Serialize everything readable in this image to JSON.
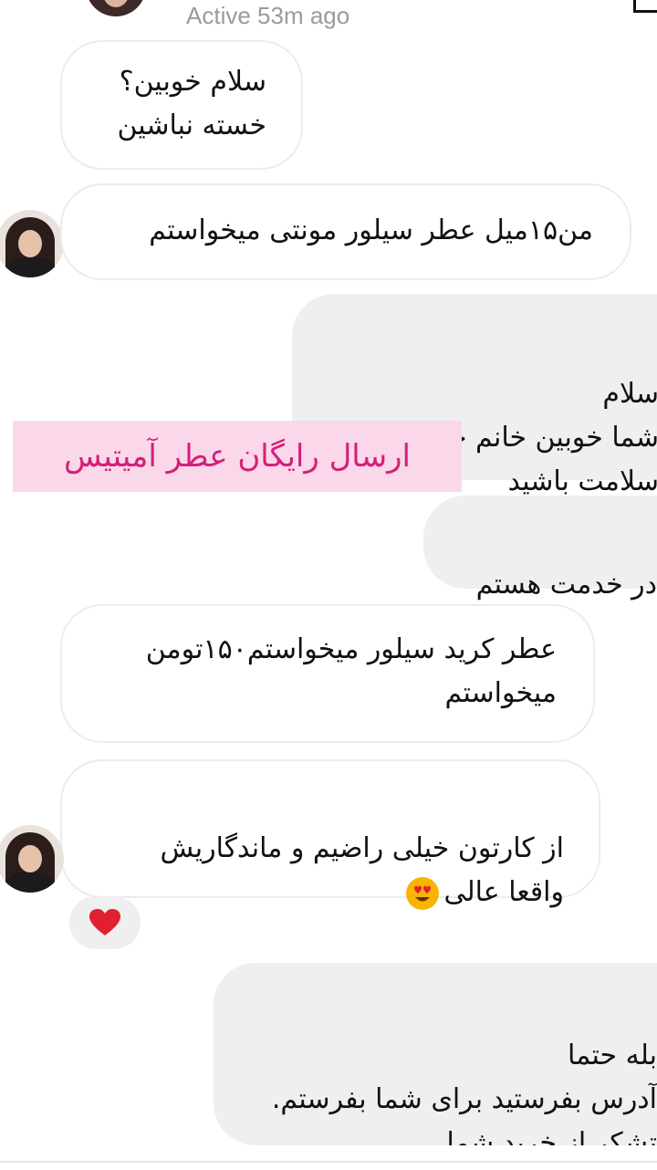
{
  "header": {
    "status": "Active 53m ago"
  },
  "messages": [
    {
      "side": "incoming",
      "text": "سلام خوبین؟\nخسته نباشین"
    },
    {
      "side": "incoming",
      "text": "من۱۵میل عطر سیلور مونتی میخواستم"
    },
    {
      "side": "outgoing",
      "text": "سلام\nشما خوبین خانم جرجانی؟\nسلامت باشید"
    },
    {
      "side": "outgoing",
      "text": "در خدمت هستم"
    },
    {
      "side": "incoming",
      "text": "عطر کرید سیلور میخواستم۱۵۰تومن\nمیخواستم"
    },
    {
      "side": "incoming",
      "text": "از کارتون خیلی راضیم و ماندگاریش\nواقعا عالی"
    },
    {
      "side": "outgoing",
      "text": "بله حتما\nآدرس بفرستید برای شما بفرستم.\nتشکر از خرید شما\nاز عطر آمیتیس"
    }
  ],
  "overlay": {
    "text": "ارسال رایگان عطر آمیتیس"
  },
  "reaction": {
    "icon": "heart-icon",
    "color": "#e0202f"
  },
  "emoji": {
    "icon": "heart-eyes-emoji",
    "color": "#f7b400"
  },
  "colors": {
    "banner_bg": "#fbd7ea",
    "banner_text": "#d41f79",
    "outgoing_bg": "#efefef"
  }
}
